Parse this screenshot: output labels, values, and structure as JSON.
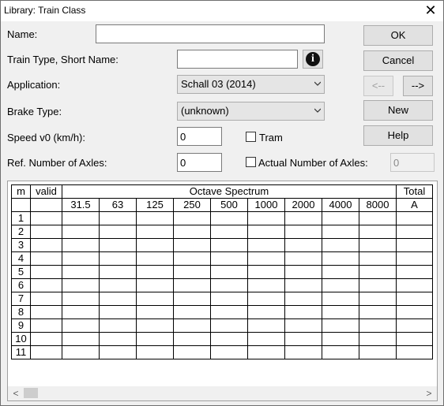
{
  "window": {
    "title": "Library: Train Class",
    "close_glyph": "✕"
  },
  "form": {
    "name_label": "Name:",
    "name_value": "",
    "short_name_label": "Train Type, Short Name:",
    "short_name_value": "",
    "application_label": "Application:",
    "application_value": "Schall 03 (2014)",
    "brake_label": "Brake Type:",
    "brake_value": "(unknown)",
    "speed_label": "Speed v0 (km/h):",
    "speed_value": "0",
    "tram_label": "Tram",
    "axles_label": "Ref. Number of Axles:",
    "axles_value": "0",
    "actual_axles_label": "Actual Number of Axles:",
    "actual_axles_value": "0",
    "info_glyph": "i"
  },
  "buttons": {
    "ok": "OK",
    "cancel": "Cancel",
    "prev": "<--",
    "next": "-->",
    "new": "New",
    "help": "Help"
  },
  "grid": {
    "header_m": "m",
    "header_valid": "valid",
    "header_spectrum": "Octave Spectrum",
    "header_total": "Total",
    "frequencies": [
      "31.5",
      "63",
      "125",
      "250",
      "500",
      "1000",
      "2000",
      "4000",
      "8000"
    ],
    "total_unit": "A",
    "rows": [
      "1",
      "2",
      "3",
      "4",
      "5",
      "6",
      "7",
      "8",
      "9",
      "10",
      "11"
    ]
  },
  "scrollbar": {
    "left_glyph": "<",
    "right_glyph": ">"
  }
}
